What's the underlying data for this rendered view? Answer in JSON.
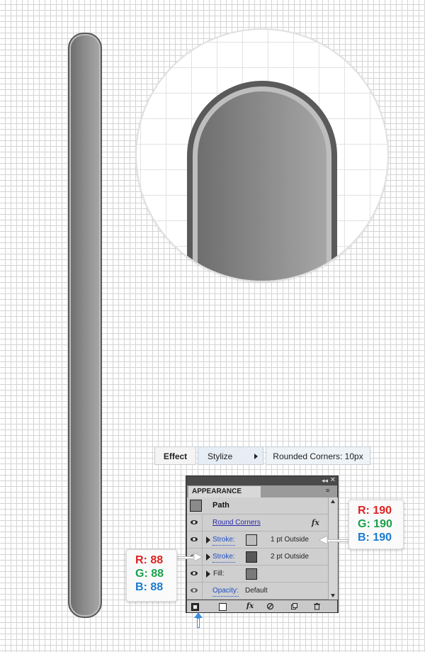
{
  "breadcrumb": {
    "effect": "Effect",
    "stylize": "Stylize",
    "rounded_corners": "Rounded Corners: 10px"
  },
  "panel": {
    "tab_label": "APPEARANCE",
    "topbar_collapse": "◂◂",
    "topbar_close": "✕",
    "menu_icon": "≡",
    "rows": {
      "path": "Path",
      "round_corners": "Round Corners",
      "stroke1_label": "Stroke:",
      "stroke1_value": "1 pt  Outside",
      "stroke2_label": "Stroke:",
      "stroke2_value": "2 pt  Outside",
      "fill_label": "Fill:",
      "opacity_label": "Opacity:",
      "opacity_value": "Default",
      "fx": "fx"
    },
    "footer_fx": "fx",
    "colors": {
      "stroke1_swatch": "#bebebe",
      "stroke2_swatch": "#585858",
      "fill_swatch": "#7a7a7a"
    }
  },
  "callouts": {
    "light": {
      "r": "R: 190",
      "g": "G: 190",
      "b": "B: 190"
    },
    "dark": {
      "r": "R: 88",
      "g": "G: 88",
      "b": "B: 88"
    }
  },
  "icons": [
    "eye-icon",
    "disclosure-triangle-icon",
    "fx-icon",
    "panel-menu-icon",
    "add-new-stroke-icon",
    "add-new-fill-icon",
    "clear-appearance-icon",
    "duplicate-item-icon",
    "delete-item-icon",
    "scroll-up-icon",
    "scroll-down-icon"
  ]
}
